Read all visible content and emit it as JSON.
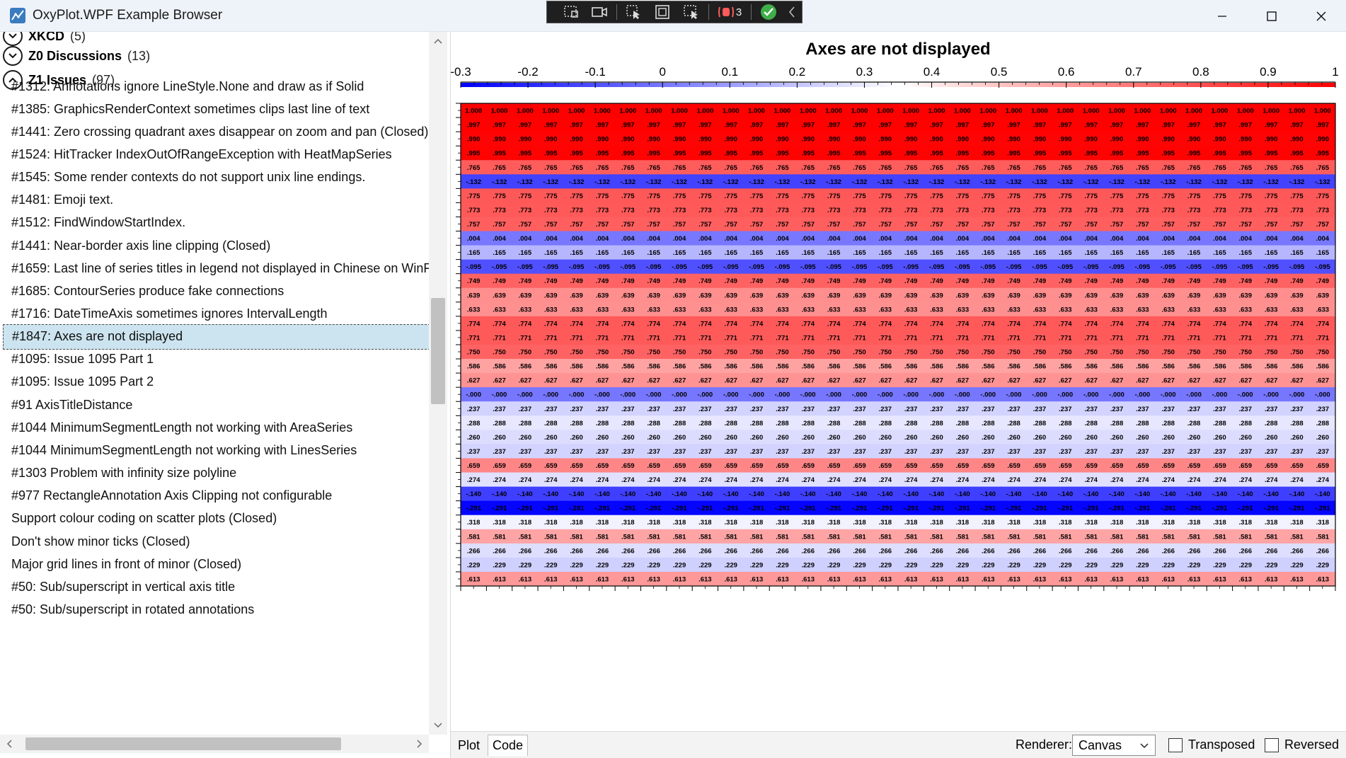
{
  "window": {
    "title": "OxyPlot.WPF Example Browser",
    "debug_badge": "3"
  },
  "groups": [
    {
      "name": "XKCD",
      "count": "(5)"
    },
    {
      "name": "Z0 Discussions",
      "count": "(13)"
    },
    {
      "name": "Z1 Issues",
      "count": "(97)"
    }
  ],
  "examples": [
    "#1312: Annotations ignore LineStyle.None and draw as if Solid",
    "#1385: GraphicsRenderContext sometimes clips last line of text",
    "#1441: Zero crossing quadrant axes disappear on zoom and pan (Closed)",
    "#1524: HitTracker IndexOutOfRangeException with HeatMapSeries",
    "#1545: Some render contexts do not support unix line endings.",
    "#1481: Emoji text.",
    "#1512: FindWindowStartIndex.",
    "#1441: Near-border axis line clipping (Closed)",
    "#1659: Last line of series titles in legend not displayed in Chinese on WinFor",
    "#1685: ContourSeries produce fake connections",
    "#1716: DateTimeAxis sometimes ignores IntervalLength",
    "#1847: Axes are not displayed",
    "#1095: Issue 1095 Part 1",
    "#1095: Issue 1095 Part 2",
    "#91 AxisTitleDistance",
    "#1044 MinimumSegmentLength not working with AreaSeries",
    "#1044 MinimumSegmentLength not working with LinesSeries",
    "#1303 Problem with infinity size polyline",
    "#977 RectangleAnnotation Axis Clipping not configurable",
    "Support colour coding on scatter plots (Closed)",
    "Don't show minor ticks (Closed)",
    "Major grid lines in front of minor (Closed)",
    "#50: Sub/superscript in vertical axis title",
    "#50: Sub/superscript in rotated annotations"
  ],
  "selected_index": 11,
  "tabs": {
    "plot": "Plot",
    "code": "Code"
  },
  "renderer": {
    "label": "Renderer:",
    "value": "Canvas"
  },
  "options": {
    "transposed": "Transposed",
    "reversed": "Reversed"
  },
  "chart_data": {
    "type": "heatmap",
    "title": "Axes are not displayed",
    "color_axis": {
      "min": -0.3,
      "max": 1,
      "ticks": [
        "-0.3",
        "-0.2",
        "-0.1",
        "0",
        "0.1",
        "0.2",
        "0.3",
        "0.4",
        "0.5",
        "0.6",
        "0.7",
        "0.8",
        "0.9",
        "1"
      ],
      "palette": [
        "#0000ff",
        "#ffffff",
        "#ff0000"
      ]
    },
    "columns": 34,
    "row_values": [
      1.0,
      0.997,
      0.99,
      0.995,
      0.765,
      -0.132,
      0.775,
      0.773,
      0.757,
      0.004,
      0.165,
      -0.095,
      0.749,
      0.639,
      0.633,
      0.774,
      0.771,
      0.75,
      0.586,
      0.627,
      -0.0,
      0.237,
      0.288,
      0.26,
      0.237,
      0.659,
      0.274,
      -0.14,
      -0.291,
      0.318,
      0.581,
      0.266,
      0.229,
      0.613
    ],
    "row_labels": [
      "1.000",
      ".997",
      ".990",
      ".995",
      ".765",
      "-.132",
      ".775",
      ".773",
      ".757",
      ".004",
      ".165",
      "-.095",
      ".749",
      ".639",
      ".633",
      ".774",
      ".771",
      ".750",
      ".586",
      ".627",
      "-.000",
      ".237",
      ".288",
      ".260",
      ".237",
      ".659",
      ".274",
      "-.140",
      "-.291",
      ".318",
      ".581",
      ".266",
      ".229",
      ".613"
    ],
    "axes_visible": false
  }
}
